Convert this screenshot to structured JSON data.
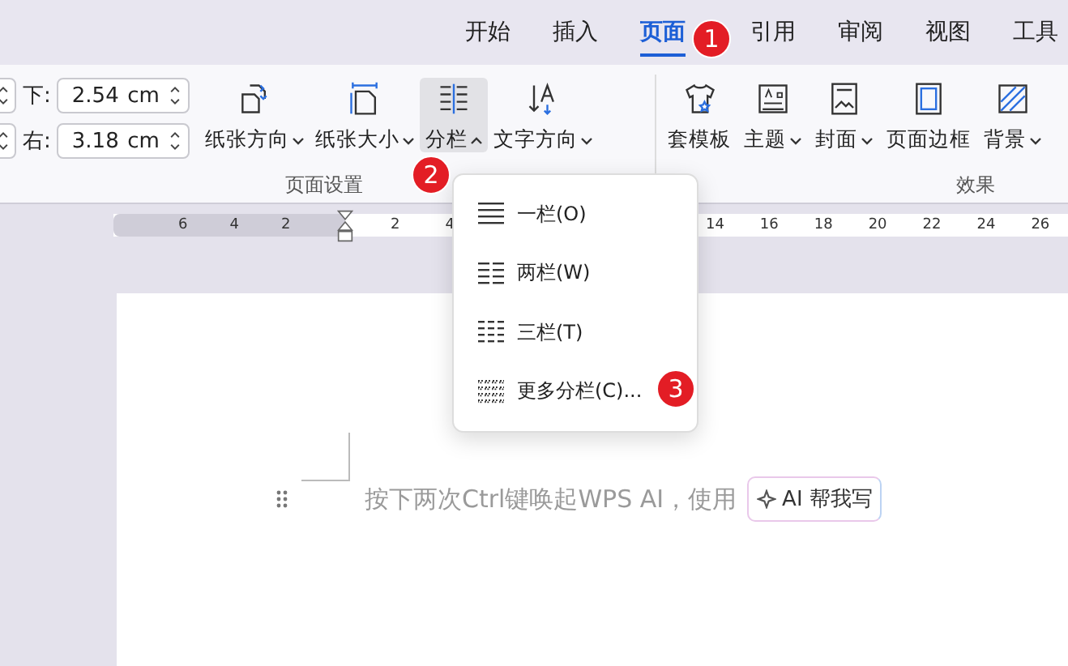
{
  "tabs": [
    {
      "label": "开始",
      "selected": false
    },
    {
      "label": "插入",
      "selected": false
    },
    {
      "label": "页面",
      "selected": true
    },
    {
      "label": "引用",
      "selected": false
    },
    {
      "label": "审阅",
      "selected": false
    },
    {
      "label": "视图",
      "selected": false
    },
    {
      "label": "工具",
      "selected": false
    }
  ],
  "page_setup": {
    "fields": [
      {
        "label": "下:",
        "value": "2.54",
        "unit": "cm"
      },
      {
        "label": "右:",
        "value": "3.18",
        "unit": "cm"
      }
    ],
    "buttons": [
      {
        "label": "纸张方向",
        "kind": "orientation",
        "dropdown": true,
        "expanded": false,
        "selected": false
      },
      {
        "label": "纸张大小",
        "kind": "size",
        "dropdown": true,
        "expanded": false,
        "selected": false
      },
      {
        "label": "分栏",
        "kind": "columns",
        "dropdown": true,
        "expanded": true,
        "selected": true
      },
      {
        "label": "文字方向",
        "kind": "direction",
        "dropdown": true,
        "expanded": false,
        "selected": false
      }
    ],
    "group_label": "页面设置"
  },
  "effects": {
    "buttons": [
      {
        "label": "套模板",
        "kind": "template",
        "dropdown": false
      },
      {
        "label": "主题",
        "kind": "theme",
        "dropdown": true
      },
      {
        "label": "封面",
        "kind": "cover",
        "dropdown": true
      },
      {
        "label": "页面边框",
        "kind": "border",
        "dropdown": false
      },
      {
        "label": "背景",
        "kind": "background",
        "dropdown": true
      }
    ],
    "group_label": "效果"
  },
  "ruler": {
    "left_ticks": [
      "6",
      "4",
      "2"
    ],
    "near_ticks": [
      "2",
      "4"
    ],
    "far_ticks": [
      "14",
      "16",
      "18",
      "20",
      "22",
      "24",
      "26"
    ]
  },
  "columns_menu": {
    "items": [
      {
        "label": "一栏(O)",
        "kind": "single"
      },
      {
        "label": "两栏(W)",
        "kind": "double"
      },
      {
        "label": "三栏(T)",
        "kind": "triple"
      },
      {
        "label": "更多分栏(C)...",
        "kind": "more"
      }
    ]
  },
  "document": {
    "hint": "按下两次Ctrl键唤起WPS AI，使用",
    "ai_button": "AI 帮我写"
  },
  "callouts": [
    "1",
    "2",
    "3"
  ]
}
